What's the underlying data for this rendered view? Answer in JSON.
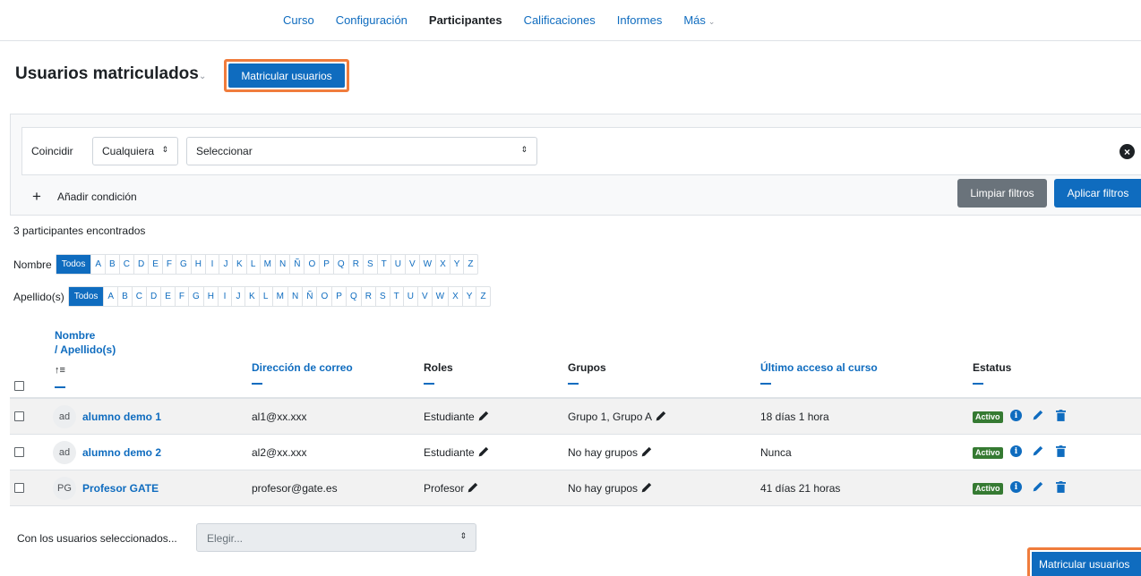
{
  "nav": {
    "items": [
      {
        "label": "Curso",
        "active": false
      },
      {
        "label": "Configuración",
        "active": false
      },
      {
        "label": "Participantes",
        "active": true
      },
      {
        "label": "Calificaciones",
        "active": false
      },
      {
        "label": "Informes",
        "active": false
      },
      {
        "label": "Más",
        "active": false
      }
    ]
  },
  "header": {
    "title": "Usuarios matriculados",
    "enrol_button": "Matricular usuarios"
  },
  "filters": {
    "match_label": "Coincidir",
    "match_value": "Cualquiera",
    "select_placeholder": "Seleccionar",
    "add_condition": "Añadir condición",
    "clear_button": "Limpiar filtros",
    "apply_button": "Aplicar filtros"
  },
  "count_text": "3 participantes encontrados",
  "initials": {
    "firstname_label": "Nombre",
    "lastname_label": "Apellido(s)",
    "all_label": "Todos",
    "letters": [
      "A",
      "B",
      "C",
      "D",
      "E",
      "F",
      "G",
      "H",
      "I",
      "J",
      "K",
      "L",
      "M",
      "N",
      "Ñ",
      "O",
      "P",
      "Q",
      "R",
      "S",
      "T",
      "U",
      "V",
      "W",
      "X",
      "Y",
      "Z"
    ]
  },
  "table": {
    "headers": {
      "name": "Nombre",
      "lastname": "/ Apellido(s)",
      "email": "Dirección de correo",
      "roles": "Roles",
      "groups": "Grupos",
      "last_access": "Último acceso al curso",
      "status": "Estatus"
    },
    "rows": [
      {
        "initials": "ad",
        "name": "alumno demo 1",
        "email": "al1@xx.xxx",
        "role": "Estudiante",
        "groups": "Grupo 1, Grupo A",
        "last_access": "18 días 1 hora",
        "status": "Activo"
      },
      {
        "initials": "ad",
        "name": "alumno demo 2",
        "email": "al2@xx.xxx",
        "role": "Estudiante",
        "groups": "No hay grupos",
        "last_access": "Nunca",
        "status": "Activo"
      },
      {
        "initials": "PG",
        "name": "Profesor GATE",
        "email": "profesor@gate.es",
        "role": "Profesor",
        "groups": "No hay grupos",
        "last_access": "41 días 21 horas",
        "status": "Activo"
      }
    ]
  },
  "bulk": {
    "label": "Con los usuarios seleccionados...",
    "placeholder": "Elegir..."
  },
  "footer": {
    "enrol_button": "Matricular usuarios"
  },
  "colors": {
    "primary": "#0f6cbf",
    "highlight": "#f07c3c",
    "success": "#357a32",
    "secondary": "#6a737b"
  },
  "icons": {
    "edit": "pencil-icon",
    "info": "info-icon",
    "delete": "trash-icon",
    "sort": "sort-asc-icon",
    "remove": "close-circle-icon"
  }
}
